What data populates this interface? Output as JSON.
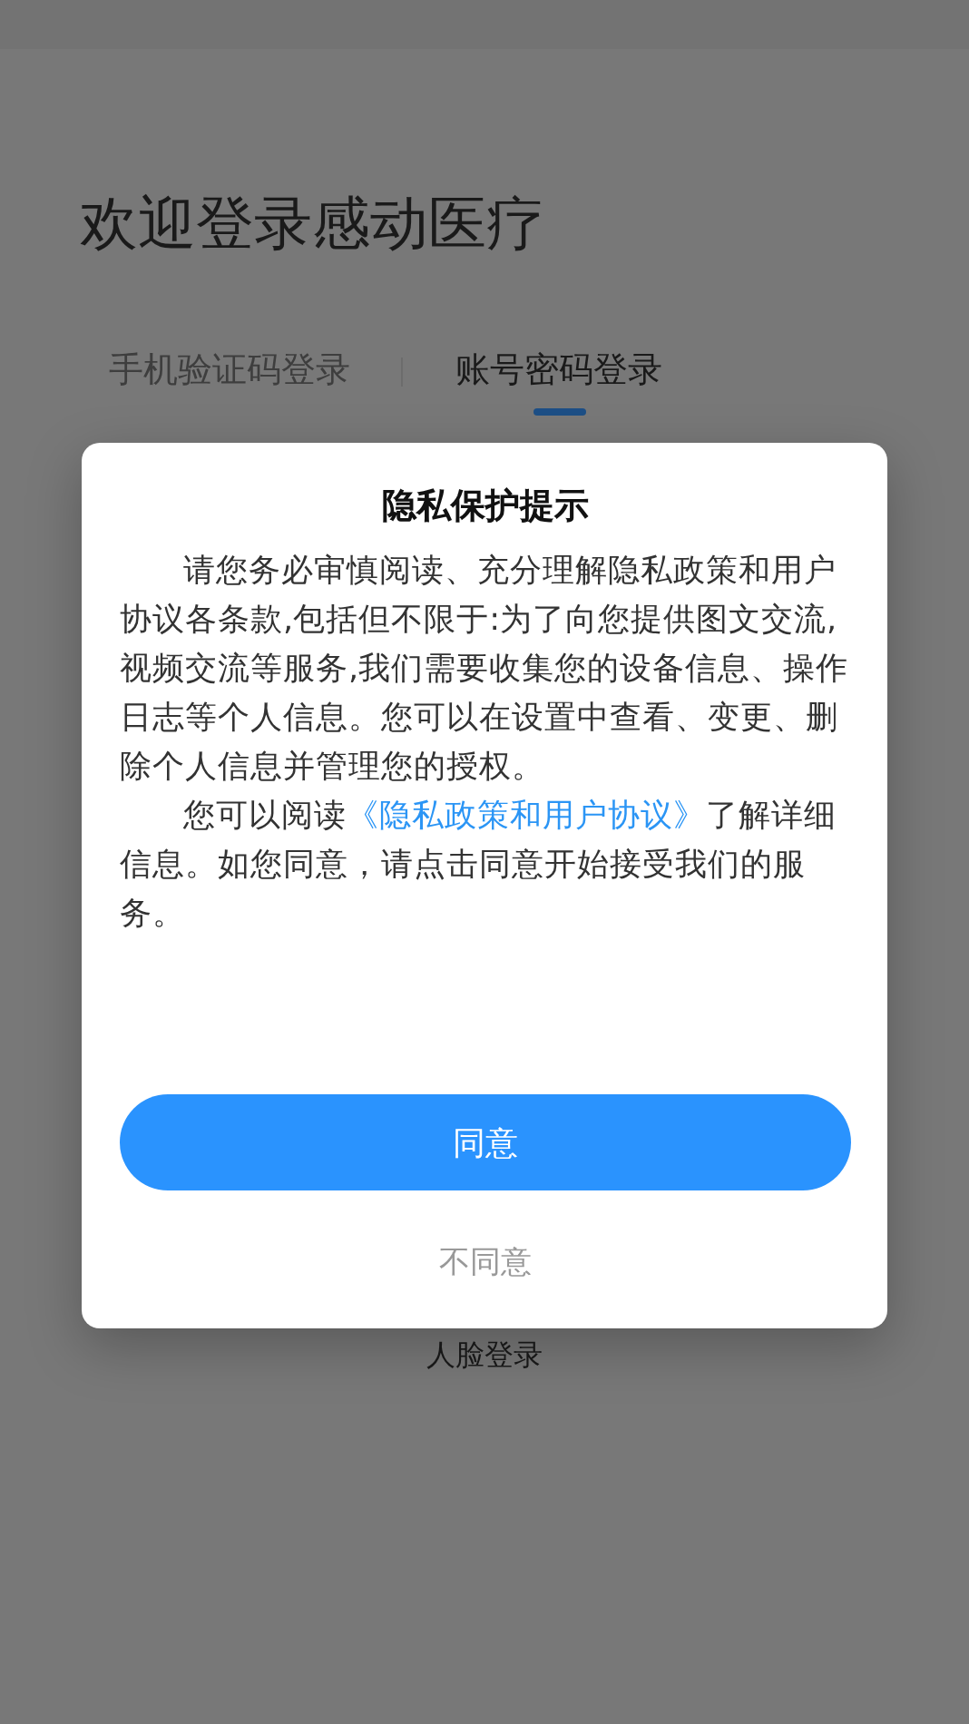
{
  "page": {
    "title": "欢迎登录感动医疗"
  },
  "tabs": [
    {
      "label": "手机验证码登录",
      "selected": false
    },
    {
      "label": "账号密码登录",
      "selected": true
    }
  ],
  "face_login": {
    "label": "人脸登录"
  },
  "dialog": {
    "title": "隐私保护提示",
    "paragraphs": [
      {
        "text": "请您务必审慎阅读、充分理解隐私政策和用户协议各条款,包括但不限于:为了向您提供图文交流,视频交流等服务,我们需要收集您的设备信息、操作日志等个人信息。您可以在设置中查看、变更、删除个人信息并管理您的授权。"
      },
      {
        "text": "您可以阅读",
        "link": "《隐私政策和用户协议》",
        "after": "了解详细信息。如您同意，请点击同意开始接受我们的服务。"
      }
    ],
    "agree": "同意",
    "disagree": "不同意"
  }
}
